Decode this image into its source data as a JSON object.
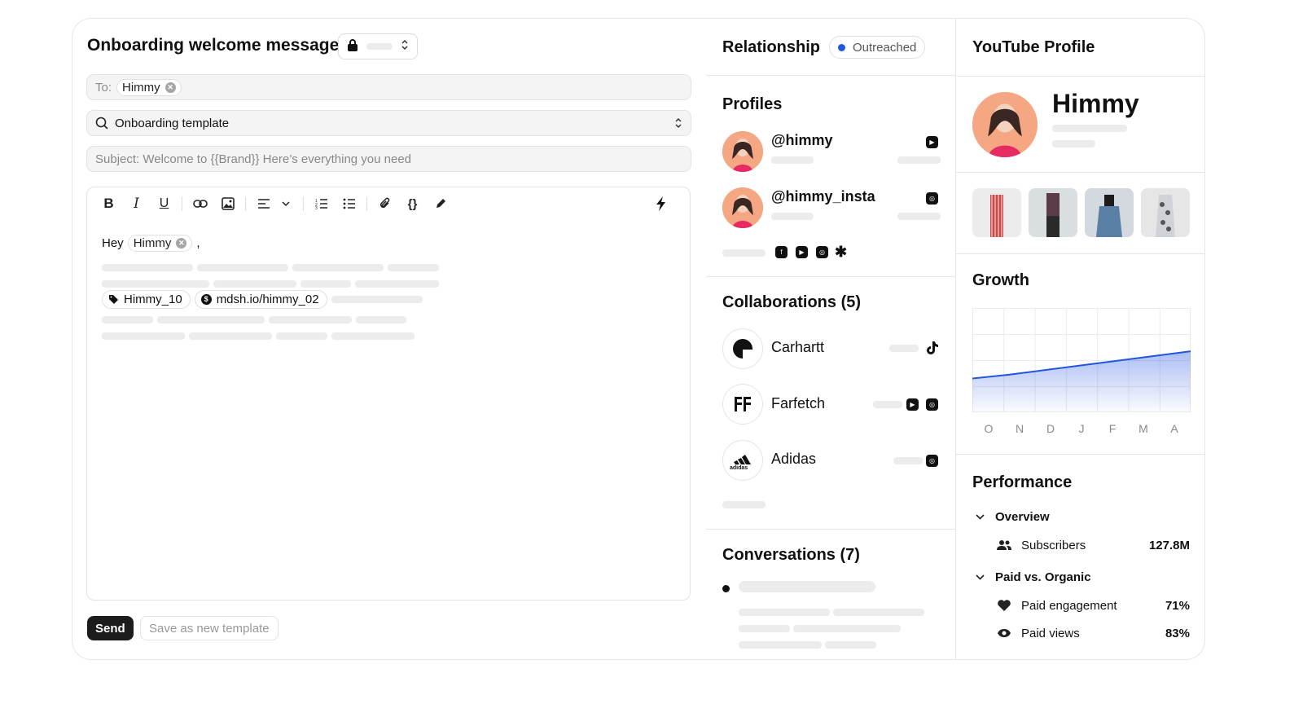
{
  "composer": {
    "title": "Onboarding welcome message",
    "to_label": "To:",
    "to_recipient": "Himmy",
    "template_value": "Onboarding template",
    "subject_value": "Subject: Welcome to {{Brand}} Here’s everything you need",
    "greeting": "Hey",
    "greeting_name": "Himmy",
    "greeting_comma": ",",
    "discount_code": "Himmy_10",
    "affiliate_link": "mdsh.io/himmy_02",
    "send_label": "Send",
    "save_template_label": "Save as new template"
  },
  "relationship": {
    "title": "Relationship",
    "status": "Outreached",
    "status_color": "#2255e0"
  },
  "profiles": {
    "title": "Profiles",
    "items": [
      {
        "handle": "@himmy",
        "platform_icon": "youtube-icon"
      },
      {
        "handle": "@himmy_insta",
        "platform_icon": "instagram-icon"
      }
    ],
    "more_platforms": [
      "facebook-icon",
      "youtube-icon",
      "instagram-icon",
      "asterisk-icon"
    ]
  },
  "collaborations": {
    "title": "Collaborations (5)",
    "items": [
      {
        "brand": "Carhartt",
        "logo": "carhartt-logo",
        "platforms": [
          "tiktok-icon"
        ]
      },
      {
        "brand": "Farfetch",
        "logo": "farfetch-logo",
        "platforms": [
          "youtube-icon",
          "instagram-icon"
        ]
      },
      {
        "brand": "Adidas",
        "logo": "adidas-logo",
        "platforms": [
          "instagram-icon"
        ]
      }
    ]
  },
  "conversations": {
    "title": "Conversations (7)"
  },
  "youtube_profile": {
    "title": "YouTube Profile",
    "name": "Himmy"
  },
  "growth": {
    "title": "Growth"
  },
  "chart_data": {
    "type": "area",
    "categories": [
      "O",
      "N",
      "D",
      "J",
      "F",
      "M",
      "A"
    ],
    "series": [
      {
        "values": [
          0.36,
          0.4,
          0.45,
          0.5,
          0.55,
          0.6,
          0.65
        ]
      }
    ],
    "color": "#2255e0",
    "grid": true,
    "title": "",
    "xlabel": "",
    "ylabel": ""
  },
  "performance": {
    "title": "Performance",
    "overview_label": "Overview",
    "subscribers_label": "Subscribers",
    "subscribers_value": "127.8M",
    "paid_vs_organic_label": "Paid vs. Organic",
    "paid_engagement_label": "Paid engagement",
    "paid_engagement_value": "71%",
    "paid_views_label": "Paid views",
    "paid_views_value": "83%"
  }
}
